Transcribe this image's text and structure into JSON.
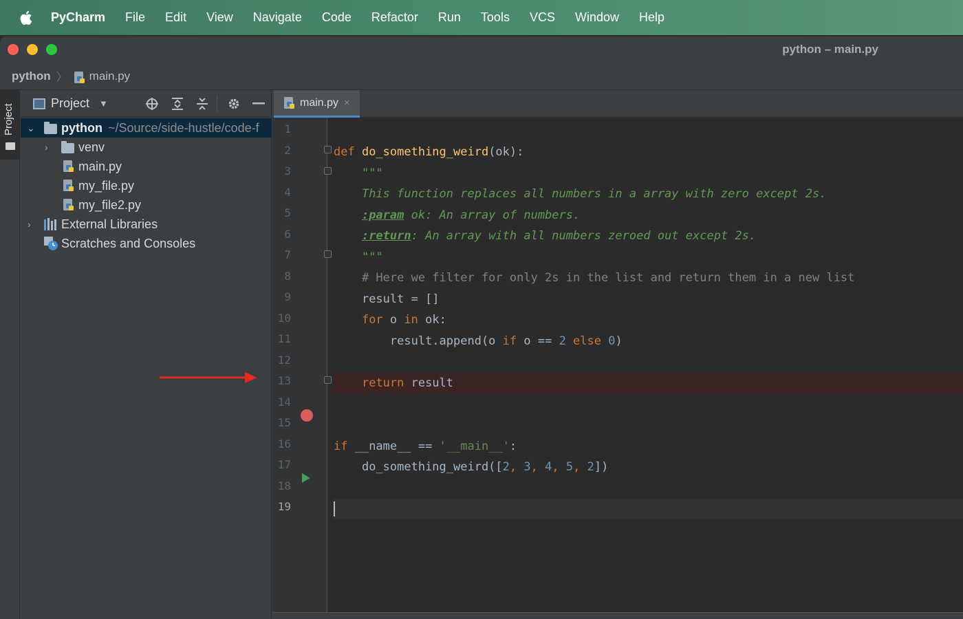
{
  "menubar": {
    "app_name": "PyCharm",
    "items": [
      "File",
      "Edit",
      "View",
      "Navigate",
      "Code",
      "Refactor",
      "Run",
      "Tools",
      "VCS",
      "Window",
      "Help"
    ]
  },
  "window": {
    "title": "python – main.py"
  },
  "breadcrumb": {
    "root": "python",
    "file": "main.py"
  },
  "toolstrip": {
    "project_tab": "Project"
  },
  "project_panel": {
    "title": "Project",
    "tree": [
      {
        "label": "python",
        "path": "~/Source/side-hustle/code-f",
        "type": "folder",
        "expanded": true,
        "selected": true
      },
      {
        "label": "venv",
        "type": "folder",
        "expanded": false
      },
      {
        "label": "main.py",
        "type": "python-file"
      },
      {
        "label": "my_file.py",
        "type": "python-file"
      },
      {
        "label": "my_file2.py",
        "type": "python-file"
      },
      {
        "label": "External Libraries",
        "type": "libraries",
        "expanded": false
      },
      {
        "label": "Scratches and Consoles",
        "type": "scratches"
      }
    ]
  },
  "editor": {
    "tab": {
      "label": "main.py",
      "close": "×"
    },
    "line_numbers": [
      "1",
      "2",
      "3",
      "4",
      "5",
      "6",
      "7",
      "8",
      "9",
      "10",
      "11",
      "12",
      "13",
      "14",
      "15",
      "16",
      "17",
      "18",
      "19"
    ],
    "current_line": 19,
    "breakpoint_line": 13,
    "run_marker_line": 16,
    "code": {
      "l2_def": "def ",
      "l2_fn": "do_something_weird",
      "l2_rest": "(ok):",
      "l3": "\"\"\"",
      "l4": "This function replaces all numbers in a array with zero except 2s.",
      "l5_tag": ":param",
      "l5_rest": " ok: An array of numbers.",
      "l6_tag": ":return",
      "l6_rest": ": An array with all numbers zeroed out except 2s.",
      "l7": "\"\"\"",
      "l8": "# Here we filter for only 2s in the list and return them in a new list",
      "l9": "result = []",
      "l10_for": "for",
      "l10_mid": " o ",
      "l10_in": "in",
      "l10_rest": " ok:",
      "l11_a": "result.append(o ",
      "l11_if": "if",
      "l11_b": " o == ",
      "l11_2": "2",
      "l11_else": " else ",
      "l11_0": "0",
      "l11_c": ")",
      "l13_return": "return",
      "l13_rest": " result",
      "l16_if": "if",
      "l16_mid": " __name__ == ",
      "l16_str": "'__main__'",
      "l16_end": ":",
      "l17_a": "do_something_weird([",
      "l17_n1": "2",
      "l17_n2": "3",
      "l17_n3": "4",
      "l17_n4": "5",
      "l17_n5": "2",
      "l17_comma": ", ",
      "l17_end": "])"
    }
  },
  "colors": {
    "breakpoint": "#db5c5c",
    "run_marker": "#499c54",
    "annotation_arrow": "#e8291c"
  }
}
